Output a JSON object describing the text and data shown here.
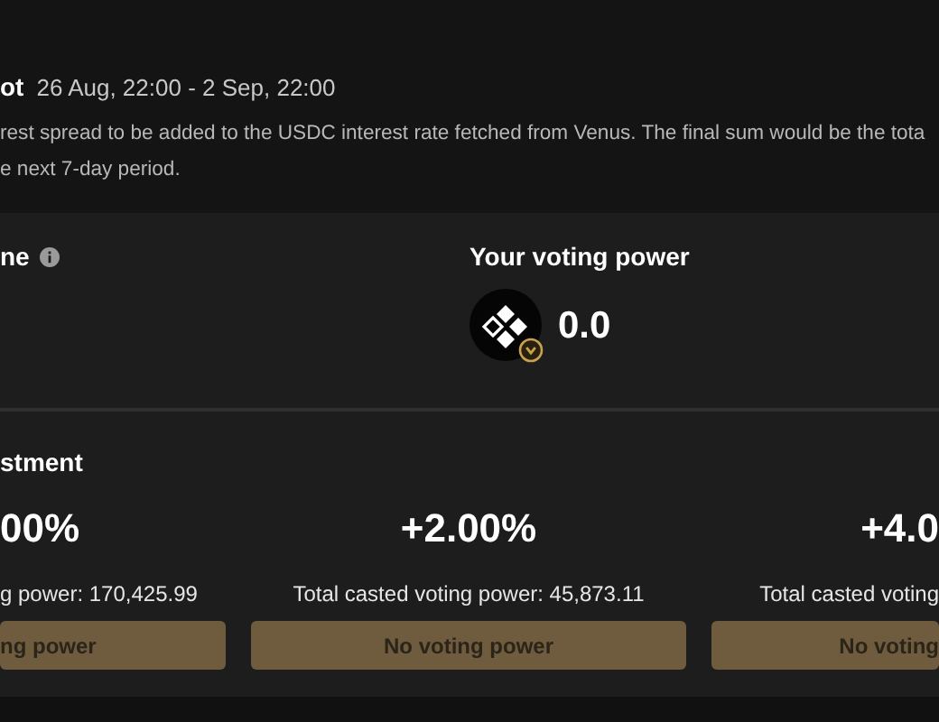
{
  "header": {
    "title": "ot",
    "date_range": "26 Aug, 22:00 - 2 Sep, 22:00",
    "description": [
      "rest spread to be added to the USDC interest rate fetched from Venus. The final sum would be the tota",
      "e next 7-day period."
    ]
  },
  "power_panel": {
    "left_label": "ne",
    "right_label": "Your voting power",
    "voting_power": "0.0"
  },
  "adjustment": {
    "title": "stment",
    "options": [
      {
        "percent": "00%",
        "caption": "g power: 170,425.99",
        "button": "ng power"
      },
      {
        "percent": "+2.00%",
        "caption": "Total casted voting power: 45,873.11",
        "button": "No voting power"
      },
      {
        "percent": "+4.0",
        "caption": "Total casted voting",
        "button": "No voting"
      }
    ]
  }
}
